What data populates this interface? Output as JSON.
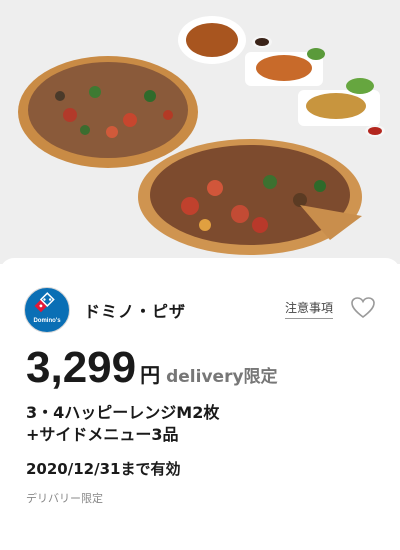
{
  "coupon": {
    "image_alt": "pizza and side menu photo",
    "brand": {
      "name": "ドミノ・ピザ",
      "logo_text": "Domino's",
      "logo_color": "#0a6fb5"
    },
    "notes_link": "注意事項",
    "favorite_icon": "heart-outline-icon",
    "price": "3,299",
    "currency": "円",
    "delivery_label": "delivery限定",
    "title_line1": "3・4ハッピーレンジM2枚",
    "title_line2": "+サイドメニュー3品",
    "valid_until": "2020/12/31まで有効",
    "restriction": "デリバリー限定"
  }
}
